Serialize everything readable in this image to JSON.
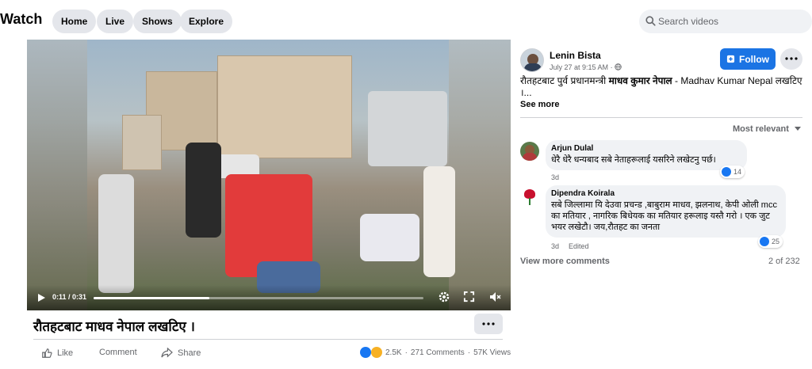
{
  "topnav": {
    "brand": "Watch",
    "items": [
      {
        "label": "Home"
      },
      {
        "label": "Live"
      },
      {
        "label": "Shows"
      },
      {
        "label": "Explore"
      }
    ],
    "search_placeholder": "Search videos",
    "search_icon": "search-icon"
  },
  "video": {
    "current_time": "0:11 / 0:31",
    "progress_fraction": 0.35,
    "controls": [
      "play-icon",
      "settings-icon",
      "fullscreen-icon",
      "volume-muted-icon"
    ]
  },
  "post": {
    "title": "रौतहटबाट माधव नेपाल लखटिए ।",
    "actions": {
      "like": "Like",
      "comment": "Comment",
      "share": "Share"
    },
    "stats": {
      "reactions": "2.5K",
      "comments": "271 Comments",
      "views": "57K Views"
    }
  },
  "author": {
    "name": "Lenin Bista",
    "date": "July 27 at 9:15 AM",
    "follow_label": "Follow"
  },
  "description": {
    "prefix": "रौतहटबाट पुर्व प्रधानमन्त्री ",
    "bold": "माधव कुमार नेपाल",
    "suffix": " - Madhav Kumar Nepal लखटिए ।...",
    "see_more": "See more"
  },
  "comments_section": {
    "sort_label": "Most relevant",
    "comments": [
      {
        "name": "Arjun Dulal",
        "text": "धेरै धेरै धन्यबाद सबे नेताहरूलाई यसरिने लखेटनु पर्छ।",
        "time": "3d",
        "likes": "14"
      },
      {
        "name": "Dipendra Koirala",
        "text": "सबे जिल्लामा यि देउवा प्रचन्ड ,बाबुराम माधव, झलनाथ, केपी ओली mcc का मतियार , नागरिक बिधेयक का मतियार हरूलाइ यस्तै गरो । एक जुट भयर लखेटौ। जय,रौतहट का जनता",
        "time": "3d",
        "edited": "Edited",
        "likes": "25"
      }
    ],
    "view_more": "View more comments",
    "count": "2 of 232"
  },
  "colors": {
    "accent": "#1b74e4",
    "pill_bg": "#e4e6eb",
    "page_bg": "#f0f2f5",
    "secondary_text": "#65676b",
    "like_blue": "#1877f2"
  }
}
